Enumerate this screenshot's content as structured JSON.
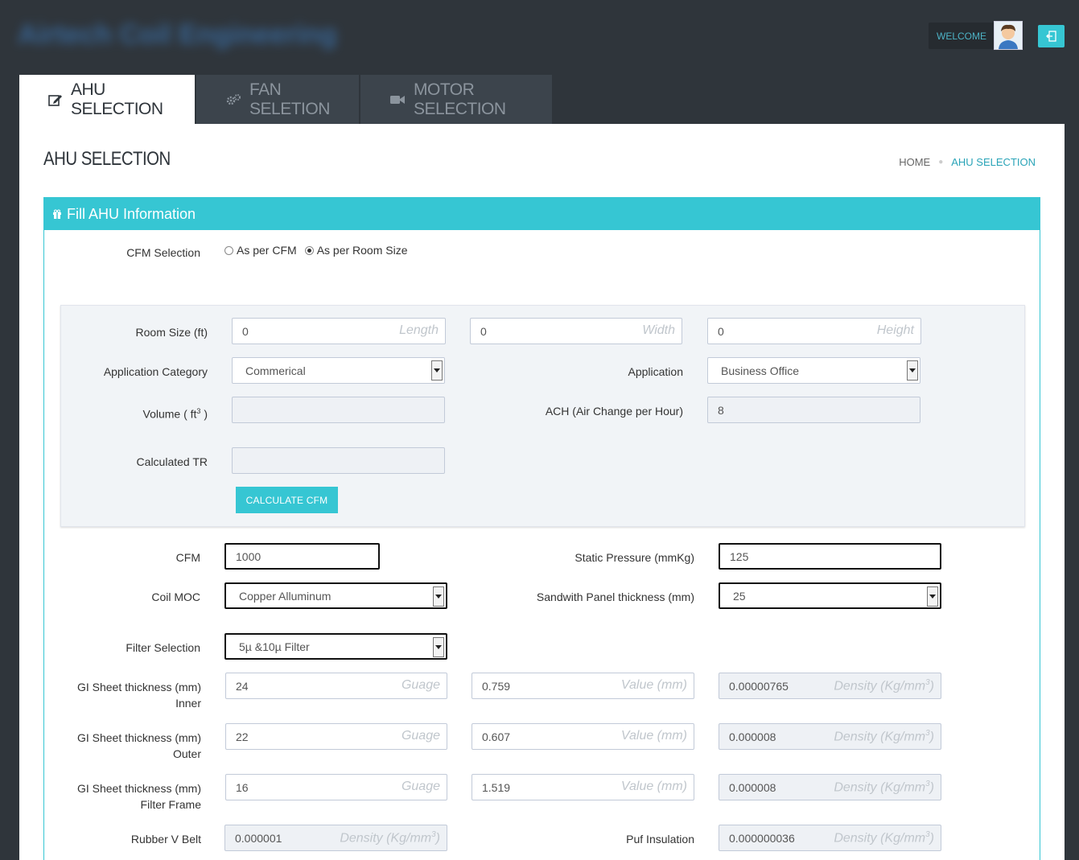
{
  "header": {
    "brand": "Airtech Coil Engineering",
    "welcome": "WELCOME"
  },
  "tabs": [
    {
      "label": "AHU SELECTION",
      "icon": "edit-icon"
    },
    {
      "label": "FAN SELETION",
      "icon": "gears-icon"
    },
    {
      "label": "MOTOR SELECTION",
      "icon": "camera-icon"
    }
  ],
  "page": {
    "title": "AHU SELECTION",
    "breadcrumb_home": "HOME",
    "breadcrumb_current": "AHU SELECTION"
  },
  "panel": {
    "title": "Fill AHU Information"
  },
  "cfm_selection": {
    "label": "CFM Selection",
    "option1": "As per CFM",
    "option2": "As per Room Size",
    "selected": "As per Room Size"
  },
  "room": {
    "room_size_label": "Room Size (ft)",
    "length": "0",
    "length_ph": "Length",
    "width": "0",
    "width_ph": "Width",
    "height": "0",
    "height_ph": "Height",
    "app_category_label": "Application Category",
    "app_category": "Commerical",
    "application_label": "Application",
    "application": "Business Office",
    "volume_label": "Volume ( ft",
    "volume_sup": "3",
    "volume_label_end": " )",
    "volume": "",
    "ach_label": "ACH (Air Change per Hour)",
    "ach": "8",
    "tr_label": "Calculated TR",
    "tr": "",
    "calc_button": "CALCULATE CFM"
  },
  "form": {
    "cfm_label": "CFM",
    "cfm": "1000",
    "static_label": "Static Pressure (mmKg)",
    "static": "125",
    "coil_label": "Coil MOC",
    "coil": "Copper Alluminum",
    "panel_label": "Sandwith Panel thickness (mm)",
    "panel": "25",
    "filter_label": "Filter Selection",
    "filter": "5µ &10µ Filter",
    "gauge_ph": "Guage",
    "value_ph": "Value (mm)",
    "density_ph": "Density (Kg/mm",
    "density_sup": "3",
    "density_ph_end": ")",
    "gi_inner_label": "GI Sheet thickness (mm) Inner",
    "gi_inner_gauge": "24",
    "gi_inner_value": "0.759",
    "gi_inner_density": "0.00000765",
    "gi_outer_label": "GI Sheet thickness (mm) Outer",
    "gi_outer_gauge": "22",
    "gi_outer_value": "0.607",
    "gi_outer_density": "0.000008",
    "gi_frame_label": "GI Sheet thickness (mm) Filter Frame",
    "gi_frame_gauge": "16",
    "gi_frame_value": "1.519",
    "gi_frame_density": "0.000008",
    "rubber_label": "Rubber V Belt",
    "rubber_density": "0.000001",
    "puf_label": "Puf Insulation",
    "puf_density": "0.000000036"
  },
  "colors": {
    "accent": "#36c6d3",
    "topbar": "#2f353b",
    "tab_inactive": "#3c444c"
  }
}
